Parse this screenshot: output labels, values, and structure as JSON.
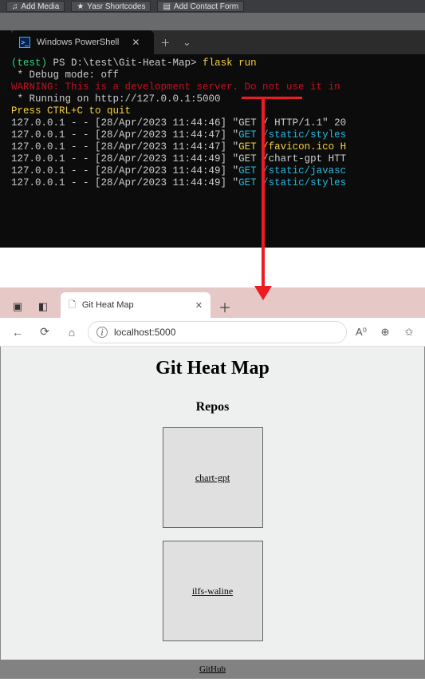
{
  "wp": {
    "add_media": "Add Media",
    "yasr": "Yasr Shortcodes",
    "contact": "Add Contact Form"
  },
  "terminal": {
    "tab_title": "Windows PowerShell",
    "env": "(test)",
    "prompt": "PS D:\\test\\Git-Heat-Map>",
    "cmd": "flask run",
    "dbg_prefix": " * ",
    "dbg": "Debug mode: off",
    "warn": "WARNING: This is a development server. Do not use it in ",
    "run_prefix": " * ",
    "run": "Running on http://127.0.0.1:5000",
    "ctrl": "Press CTRL+C to quit",
    "logs": [
      {
        "ip": "127.0.0.1 - - ",
        "ts": "[28/Apr/2023 11:44:46]",
        "mid": " \"",
        "meth": "GET / HTTP/1.1\" 20"
      },
      {
        "ip": "127.0.0.1 - - ",
        "ts": "[28/Apr/2023 11:44:47]",
        "mid": " \"",
        "meth": "GET /static/styles"
      },
      {
        "ip": "127.0.0.1 - - ",
        "ts": "[28/Apr/2023 11:44:47]",
        "mid": " \"",
        "meth": "GET /favicon.ico H"
      },
      {
        "ip": "127.0.0.1 - - ",
        "ts": "[28/Apr/2023 11:44:49]",
        "mid": " \"",
        "meth": "GET /chart-gpt HTT"
      },
      {
        "ip": "127.0.0.1 - - ",
        "ts": "[28/Apr/2023 11:44:49]",
        "mid": " \"",
        "meth": "GET /static/javasc"
      },
      {
        "ip": "127.0.0.1 - - ",
        "ts": "[28/Apr/2023 11:44:49]",
        "mid": " \"",
        "meth": "GET /static/styles"
      }
    ]
  },
  "browser": {
    "tab_title": "Git Heat Map",
    "url": "localhost:5000"
  },
  "page": {
    "title": "Git Heat Map",
    "subtitle": "Repos",
    "repos": [
      "chart-gpt",
      "ilfs-waline"
    ],
    "footer": "GitHub"
  }
}
